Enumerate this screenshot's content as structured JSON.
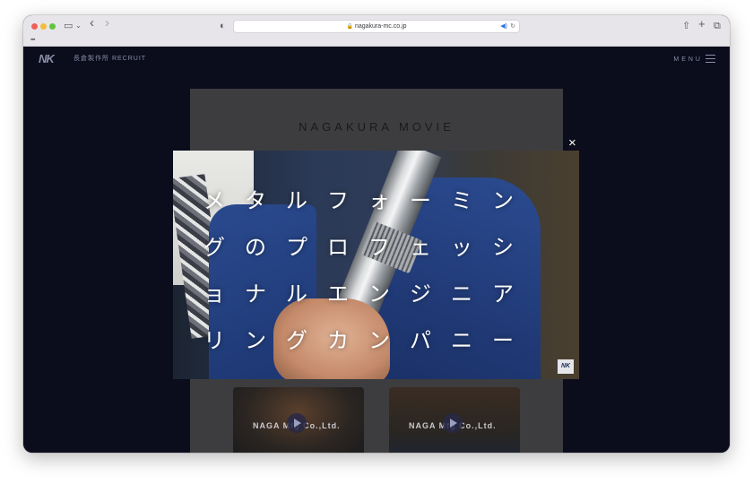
{
  "browser": {
    "url": "nagakura-mc.co.jp",
    "icons": {
      "sidebar": "▭",
      "chevron": "⌄",
      "back": "‹",
      "forward": "›",
      "privacy": "◐",
      "lock": "🔒",
      "audio": "◀)",
      "reload": "↻",
      "share": "⇧",
      "new_tab": "+",
      "tabs": "⧉",
      "grid": "▪▪▪"
    }
  },
  "site": {
    "logo": "NK",
    "name": "長倉製作所 RECRUIT",
    "menu_label": "MENU"
  },
  "movie_section": {
    "title": "NAGAKURA MOVIE",
    "thumbnails": [
      {
        "label": "NAGA Mfg Co.,Ltd."
      },
      {
        "label": "NAGA Mfg Co.,Ltd."
      }
    ]
  },
  "modal": {
    "close_label": "×",
    "video_lines": [
      "メタルフォーミン",
      "グのプロフェッシ",
      "ョナルエンジニア",
      "リングカンパニー"
    ],
    "video_logo": "NK"
  }
}
